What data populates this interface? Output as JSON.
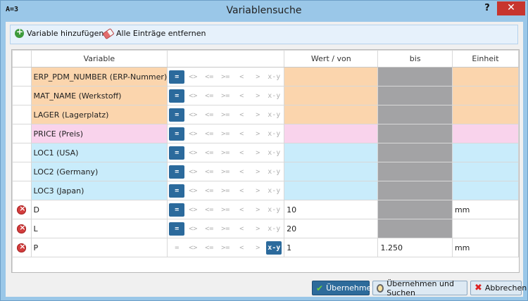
{
  "window": {
    "app_icon": "A=3",
    "title": "Variablensuche",
    "help": "?",
    "close": "✕"
  },
  "toolbar": {
    "add_label": "Variable hinzufügen",
    "remove_all_label": "Alle Einträge entfernen"
  },
  "table": {
    "headers": {
      "variable": "Variable",
      "wert": "Wert / von",
      "bis": "bis",
      "einheit": "Einheit"
    },
    "rows": [
      {
        "name": "ERP_PDM_NUMBER (ERP-Nummer)",
        "tint": "orange",
        "deletable": false,
        "active_op": "=",
        "wert": "",
        "bis": "",
        "bis_gray": true,
        "einheit": ""
      },
      {
        "name": "MAT_NAME (Werkstoff)",
        "tint": "orange",
        "deletable": false,
        "active_op": "=",
        "wert": "",
        "bis": "",
        "bis_gray": true,
        "einheit": ""
      },
      {
        "name": "LAGER (Lagerplatz)",
        "tint": "orange",
        "deletable": false,
        "active_op": "=",
        "wert": "",
        "bis": "",
        "bis_gray": true,
        "einheit": ""
      },
      {
        "name": "PRICE (Preis)",
        "tint": "pink",
        "deletable": false,
        "active_op": "=",
        "wert": "",
        "bis": "",
        "bis_gray": true,
        "einheit": ""
      },
      {
        "name": "LOC1 (USA)",
        "tint": "blue",
        "deletable": false,
        "active_op": "=",
        "wert": "",
        "bis": "",
        "bis_gray": true,
        "einheit": ""
      },
      {
        "name": "LOC2 (Germany)",
        "tint": "blue",
        "deletable": false,
        "active_op": "=",
        "wert": "",
        "bis": "",
        "bis_gray": true,
        "einheit": ""
      },
      {
        "name": "LOC3 (Japan)",
        "tint": "blue",
        "deletable": false,
        "active_op": "=",
        "wert": "",
        "bis": "",
        "bis_gray": true,
        "einheit": ""
      },
      {
        "name": "D",
        "tint": "none",
        "deletable": true,
        "active_op": "=",
        "wert": "10",
        "bis": "",
        "bis_gray": true,
        "einheit": "mm"
      },
      {
        "name": "L",
        "tint": "none",
        "deletable": true,
        "active_op": "=",
        "wert": "20",
        "bis": "",
        "bis_gray": true,
        "einheit": ""
      },
      {
        "name": "P",
        "tint": "none",
        "deletable": true,
        "active_op": "x-y",
        "wert": "1",
        "bis": "1.250",
        "bis_gray": false,
        "einheit": "mm"
      }
    ],
    "operators": [
      "=",
      "<>",
      "<=",
      ">=",
      "<",
      ">",
      "x-y"
    ]
  },
  "footer": {
    "ok_label": "Übernehmen",
    "ok_search_label": "Übernehmen und Suchen",
    "cancel_label": "Abbrechen"
  },
  "colors": {
    "orange": "#fbd5ad",
    "pink": "#f9d3ec",
    "blue": "#c9ecfb",
    "gray": "#a3a3a5",
    "accent": "#2b6a9c",
    "titlebar": "#9ac7e8",
    "close": "#c7352e"
  }
}
